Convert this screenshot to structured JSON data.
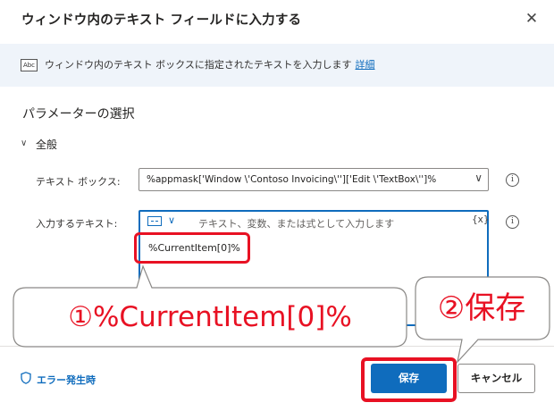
{
  "dialog": {
    "title": "ウィンドウ内のテキスト フィールドに入力する",
    "close_glyph": "✕"
  },
  "infobar": {
    "icon_text": "Abc",
    "text": "ウィンドウ内のテキスト ボックスに指定されたテキストを入力します",
    "link": "詳細"
  },
  "section": {
    "title": "パラメーターの選択",
    "group": "全般",
    "group_chevron": "∨"
  },
  "params": {
    "textbox_label": "テキスト ボックス:",
    "textbox_value": "%appmask['Window \\'Contoso Invoicing\\'']['Edit \\'TextBox\\'']%",
    "text_label": "入力するテキスト:",
    "text_placeholder": "テキスト、変数、または式として入力します",
    "var_button": "{x}",
    "text_value": "%CurrentItem[0]%",
    "info_glyph": "i",
    "chevron": "∨"
  },
  "footer": {
    "error_label": "エラー発生時",
    "save_label": "保存",
    "cancel_label": "キャンセル"
  },
  "annotations": {
    "callout1": "①%CurrentItem[0]%",
    "callout2": "②保存",
    "highlight_color": "#e81123"
  },
  "colors": {
    "accent": "#0f6cbd",
    "infobar_bg": "#eff4fa"
  }
}
